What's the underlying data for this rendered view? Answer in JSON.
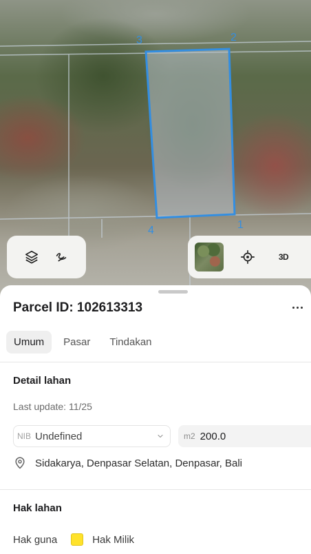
{
  "map": {
    "vertex_labels": [
      "1",
      "2",
      "3",
      "4"
    ],
    "parcel_outline_color": "#2f8fe6",
    "controls": {
      "layers_icon": "layers-icon",
      "draw_icon": "measure-line-icon",
      "locate_icon": "crosshair-icon",
      "threed_label": "3D"
    }
  },
  "sheet": {
    "title": "Parcel ID: 102613313",
    "more_icon": "more-horizontal-icon",
    "tabs": [
      {
        "label": "Umum",
        "active": true
      },
      {
        "label": "Pasar",
        "active": false
      },
      {
        "label": "Tindakan",
        "active": false
      }
    ],
    "detail": {
      "heading": "Detail lahan",
      "last_update": "Last update: 11/25",
      "nib_prefix": "NIB",
      "nib_value": "Undefined",
      "area_prefix": "m2",
      "area_value": "200.0",
      "address": "Sidakarya, Denpasar Selatan, Denpasar, Bali"
    },
    "rights": {
      "heading": "Hak lahan",
      "label": "Hak guna",
      "swatch_color": "#ffe22b",
      "value": "Hak Milik"
    }
  }
}
